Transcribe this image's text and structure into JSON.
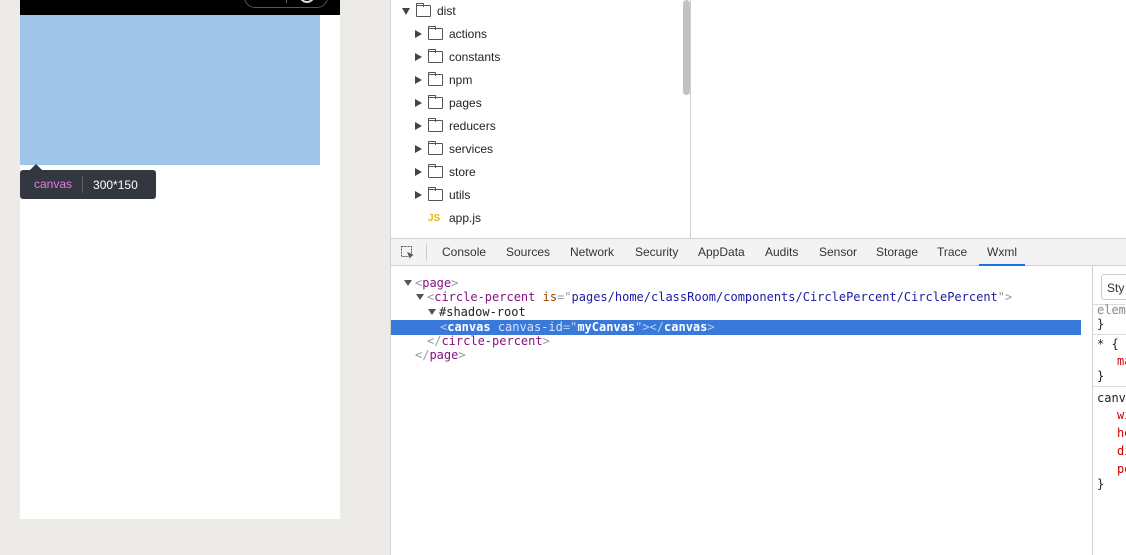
{
  "tooltip": {
    "tag": "canvas",
    "size": "300*150"
  },
  "file_tree": {
    "root": "dist",
    "folders": [
      "actions",
      "constants",
      "npm",
      "pages",
      "reducers",
      "services",
      "store",
      "utils"
    ],
    "files": [
      "app.js"
    ]
  },
  "tabs": [
    "Console",
    "Sources",
    "Network",
    "Security",
    "AppData",
    "Audits",
    "Sensor",
    "Storage",
    "Trace",
    "Wxml"
  ],
  "dom": {
    "page_open": "page",
    "circle_tag": "circle-percent",
    "circle_attr": "is",
    "circle_value": "pages/home/classRoom/components/CirclePercent/CirclePercent",
    "shadow_root": "#shadow-root",
    "canvas_tag": "canvas",
    "canvas_attr": "canvas-id",
    "canvas_value": "myCanvas",
    "circle_close": "circle-percent",
    "page_close": "page"
  },
  "styles": {
    "tab": "Sty",
    "lines": [
      "elem",
      "}",
      "* {",
      "ma",
      "}",
      "canv",
      "wi",
      "he",
      "di",
      "po",
      "}"
    ]
  }
}
